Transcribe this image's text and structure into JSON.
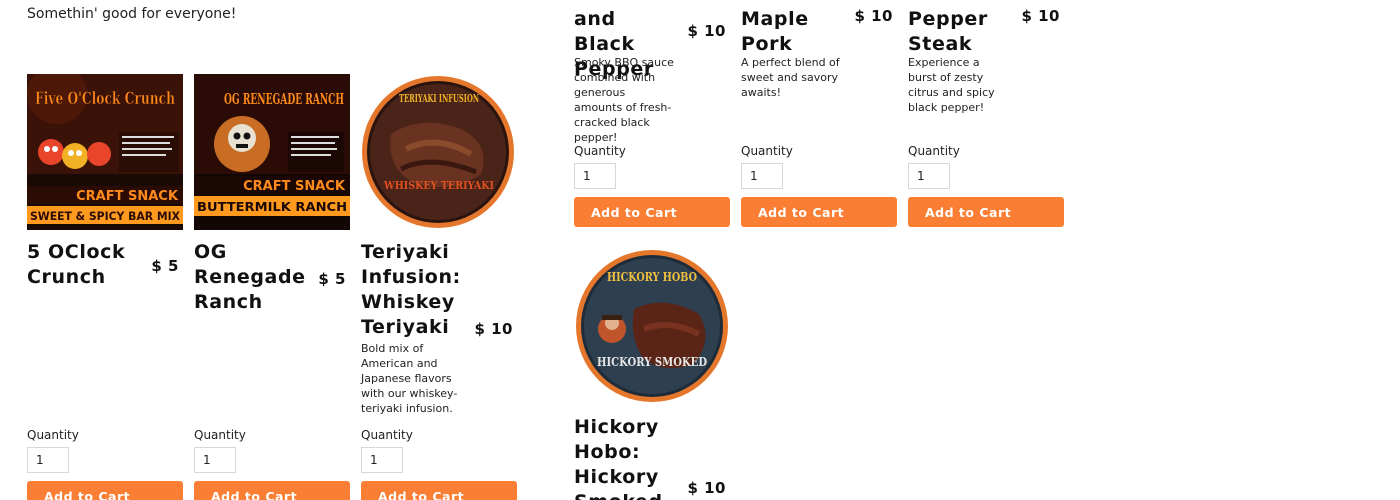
{
  "tagline": "Somethin' good for everyone!",
  "quantity_label": "Quantity",
  "add_to_cart_label": "Add to Cart",
  "colors": {
    "accent": "#fa7f34",
    "button_text": "#ffffff",
    "text": "#111111"
  },
  "products": [
    {
      "id": "bbq-black-pepper",
      "title": "and Black Pepper",
      "price": "$ 10",
      "description": "Smoky BBQ sauce combined with generous amounts of fresh-cracked black pepper!",
      "quantity": "1"
    },
    {
      "id": "maple-pork",
      "title": "Maple Pork",
      "price": "$ 10",
      "description": "A perfect blend of sweet and savory awaits!",
      "quantity": "1"
    },
    {
      "id": "pepper-steak",
      "title": "Pepper Steak",
      "price": "$ 10",
      "description": "Experience a burst of zesty citrus and spicy black pepper!",
      "quantity": "1"
    },
    {
      "id": "5-oclock-crunch",
      "title": "5 OClock Crunch",
      "price": "$ 5",
      "image_text_top": "Five O'Clock Crunch",
      "image_text_bottom": "SWEET & SPICY BAR MIX",
      "image_banner": "CRAFT SNACK",
      "quantity": "1"
    },
    {
      "id": "og-renegade-ranch",
      "title": "OG Renegade Ranch",
      "price": "$ 5",
      "image_text_top": "OG RENEGADE RANCH",
      "image_text_bottom": "BUTTERMILK RANCH",
      "image_banner": "CRAFT SNACK",
      "quantity": "1"
    },
    {
      "id": "teriyaki-infusion",
      "title": "Teriyaki Infusion: Whiskey Teriyaki",
      "price": "$ 10",
      "description": "Bold mix of American and Japanese flavors with our whiskey-teriyaki infusion.",
      "image_text_top": "TERIYAKI INFUSION",
      "image_text_bottom": "WHISKEY TERIYAKI",
      "quantity": "1"
    },
    {
      "id": "hickory-hobo",
      "title": "Hickory Hobo: Hickory Smoked",
      "price": "$ 10",
      "image_text_top": "HICKORY HOBO",
      "image_text_bottom": "HICKORY SMOKED"
    }
  ]
}
